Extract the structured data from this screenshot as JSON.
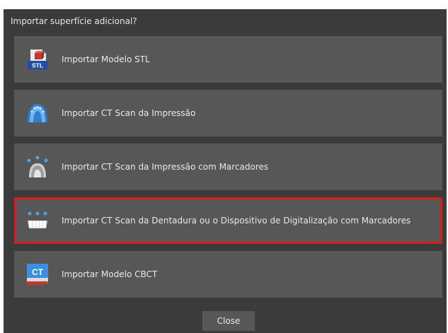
{
  "dialog": {
    "title": "Importar superfície adicional?",
    "options": [
      {
        "label": "Importar Modelo STL",
        "icon": "stl-file-icon"
      },
      {
        "label": "Importar CT Scan da Impressão",
        "icon": "impression-tray-icon"
      },
      {
        "label": "Importar CT Scan da Impressão com Marcadores",
        "icon": "impression-markers-icon"
      },
      {
        "label": "Importar CT Scan da Dentadura ou o Dispositivo de Digitalização com Marcadores",
        "icon": "denture-markers-icon",
        "selected": true
      },
      {
        "label": "Importar Modelo CBCT",
        "icon": "ct-model-icon"
      }
    ],
    "close_label": "Close"
  },
  "colors": {
    "dialog_bg": "#3b3b3b",
    "option_bg": "#575757",
    "selection_border": "#d81b1b",
    "text": "#e8e8e8"
  }
}
